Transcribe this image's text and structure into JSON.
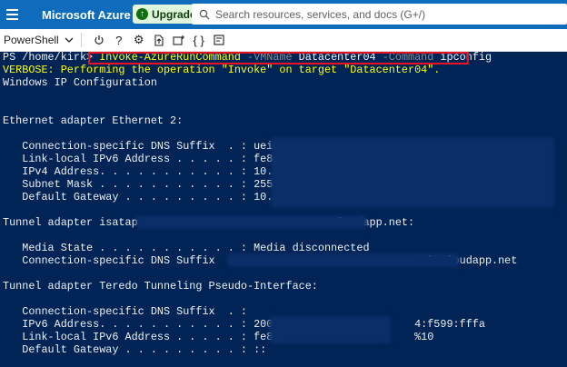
{
  "topbar": {
    "brand": "Microsoft Azure",
    "upgrade_label": "Upgrade",
    "search_placeholder": "Search resources, services, and docs (G+/)"
  },
  "toolbar": {
    "shell": "PowerShell"
  },
  "terminal": {
    "prompt": "PS /home/kirk> ",
    "cmd": "Invoke-AzureRunCommand",
    "p1": " -VMName",
    "v1": " Datacenter04",
    "p2": " -Command",
    "v2": " ipconfig",
    "verbose": "VERBOSE: Performing the operation \"Invoke\" on target \"Datacenter04\".",
    "lines": [
      "Windows IP Configuration",
      "",
      "",
      "Ethernet adapter Ethernet 2:",
      "",
      "   Connection-specific DNS Suffix  . : ueiqt",
      "   Link-local IPv6 Address . . . . . : fe80::",
      "   IPv4 Address. . . . . . . . . . . : 10.102",
      "   Subnet Mask . . . . . . . . . . . : 255.25",
      "   Default Gateway . . . . . . . . . : 10.102",
      "",
      "Tunnel adapter isatap.                             cloudapp.net:",
      "",
      "   Media State . . . . . . . . . . . : Media disconnected",
      "   Connection-specific DNS Suffix  .                            nal.cloudapp.net",
      "",
      "Tunnel adapter Teredo Tunneling Pseudo-Interface:",
      "",
      "   Connection-specific DNS Suffix  . :",
      "   IPv6 Address. . . . . . . . . . . : 2001:                    4:f599:fffa",
      "   Link-local IPv6 Address . . . . . : fe80:                    %10",
      "   Default Gateway . . . . . . . . . : ::"
    ]
  }
}
